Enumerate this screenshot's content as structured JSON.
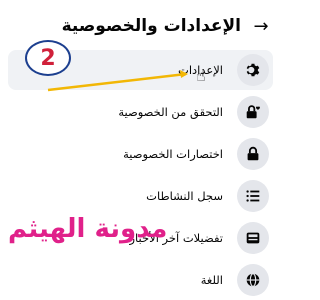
{
  "header": {
    "title": "الإعدادات والخصوصية",
    "back_icon": "arrow-right-icon"
  },
  "menu": {
    "items": [
      {
        "label": "الإعدادات",
        "icon": "gear-icon",
        "active": true
      },
      {
        "label": "التحقق من الخصوصية",
        "icon": "lock-heart-icon",
        "active": false
      },
      {
        "label": "اختصارات الخصوصية",
        "icon": "lock-icon",
        "active": false
      },
      {
        "label": "سجل النشاطات",
        "icon": "activity-list-icon",
        "active": false
      },
      {
        "label": "تفضيلات آخر الأخبار",
        "icon": "news-feed-icon",
        "active": false
      },
      {
        "label": "اللغة",
        "icon": "globe-icon",
        "active": false
      }
    ]
  },
  "annotation": {
    "step_number": "2",
    "watermark": "مدونة الهيثم",
    "arrow_color": "#f2b705",
    "badge_text_color": "#d0203a",
    "watermark_color": "#e0218a"
  }
}
